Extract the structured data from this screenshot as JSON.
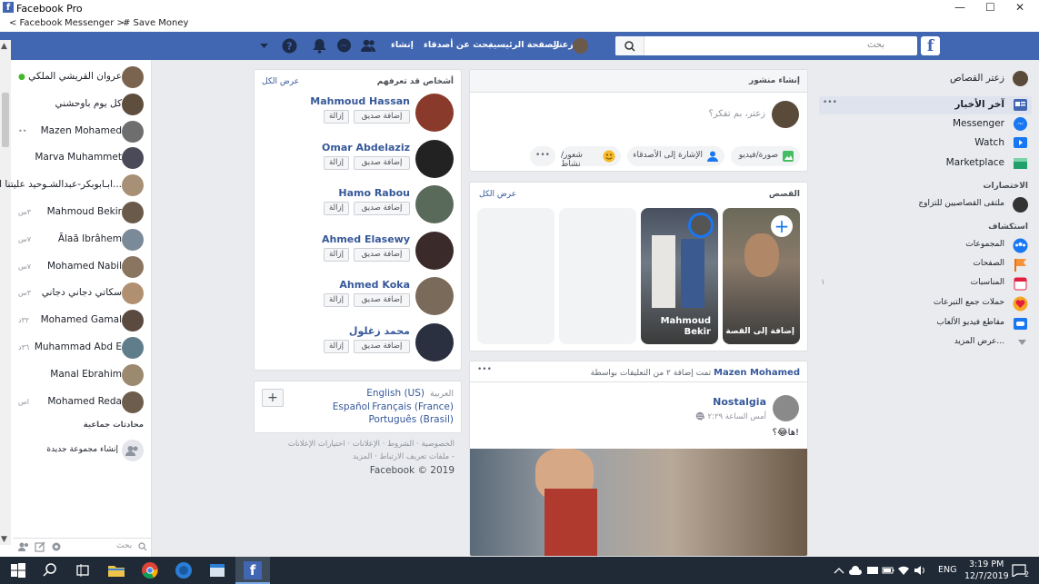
{
  "window": {
    "title": "Facebook Pro",
    "minimize": "—",
    "maximize": "☐",
    "close": "✕"
  },
  "bookmarks": [
    "< Facebook",
    "Messenger >",
    "# Save Money"
  ],
  "topnav": {
    "search_placeholder": "بحث",
    "profile_name": "زعتر",
    "home": "الصفحة الرئيسية",
    "find_friends": "بحث عن أصدقاء",
    "create": "إنشاء"
  },
  "contacts": [
    {
      "name": "عروان القريشي الملكي",
      "status": "●"
    },
    {
      "name": "كل يوم باوحشني",
      "status": ""
    },
    {
      "name": "Mazen Mohamed",
      "status": "••"
    },
    {
      "name": "Marva Muhammet",
      "status": ""
    },
    {
      "name": "ابـابوبكر-عبدالشـوحيد عليتنا الـبـ- بع...",
      "status": "..."
    },
    {
      "name": "Mahmoud Bekir",
      "status": "٣س"
    },
    {
      "name": "Ãlaã Ibrâhem",
      "status": "٧س"
    },
    {
      "name": "Mohamed Nabil",
      "status": "٧س"
    },
    {
      "name": "سكاتي دجاني دجاني",
      "status": "٣س"
    },
    {
      "name": "Mohamed Gamal",
      "status": "٣٢د"
    },
    {
      "name": "Muhammad Abd E",
      "status": "٣٦د"
    },
    {
      "name": "Manal Ebrahim",
      "status": ""
    },
    {
      "name": "Mohamed Reda",
      "status": "اس"
    }
  ],
  "group_chats": {
    "heading": "محادثات جماعية",
    "create": "إنشاء مجموعة جديدة"
  },
  "leftbottom": {
    "search": "بحث"
  },
  "pymk": {
    "title": "أشخاص قد تعرفهم",
    "see_all": "عرض الكل",
    "add_label": "إضافة صديق",
    "remove_label": "إزالة",
    "people": [
      "Mahmoud Hassan",
      "Omar Abdelaziz",
      "Hamo Rabou",
      "Ahmed Elasewy",
      "Ahmed Koka",
      "محمد زغلول"
    ]
  },
  "languages": {
    "current": "العربية",
    "list": [
      "English (US)",
      "Français (France)",
      "Español",
      "Português (Brasil)"
    ],
    "add": "+"
  },
  "footer": {
    "line1": "الخصوصية · الشروط · الإعلانات · اختيارات الإعلانات",
    "line2": "ملفات تعريف الارتباط · المزيد -",
    "copyright": "Facebook © 2019"
  },
  "composer": {
    "title": "إنشاء منشور",
    "placeholder": "زعتر، بم تفكر؟",
    "photo": "صورة/فيديو",
    "tag": "الإشارة إلى الأصدقاء",
    "feeling": "شعور/نشاط",
    "more": "•••"
  },
  "stories": {
    "title": "القصص",
    "see_all": "عرض الكل",
    "add": "إضافة إلى القصة",
    "friend": "Mahmoud Bekir"
  },
  "post": {
    "shared_by": "Mazen Mohamed",
    "shared_text": "تمت إضافة ٢ من التعليقات بواسطة",
    "page": "Nostalgia",
    "time": "أمس الساعة ٢:٢٩ م",
    "caption": "ها😂؟!",
    "more": "•••"
  },
  "rightnav": {
    "profile": "زعتر القصاص",
    "items": [
      "آخر الأخبار",
      "Messenger",
      "Watch",
      "Marketplace"
    ],
    "shortcuts_title": "الاختصارات",
    "shortcut": "ملتقى القصاصيين للتزاوج",
    "explore_title": "استكشاف",
    "explore": [
      "المجموعات",
      "الصفحات",
      "المناسبات",
      "حملات جمع التبرعات",
      "مقاطع فيديو الألعاب"
    ],
    "events_count": "١",
    "see_more": "عرض المزيد..."
  },
  "taskbar": {
    "lang": "ENG",
    "time": "3:19 PM",
    "date": "12/7/2019",
    "notif": "2"
  },
  "colors": {
    "fb_blue": "#4267b2",
    "link": "#365899",
    "bg": "#e9ebee",
    "taskbar": "#1f2a36"
  }
}
